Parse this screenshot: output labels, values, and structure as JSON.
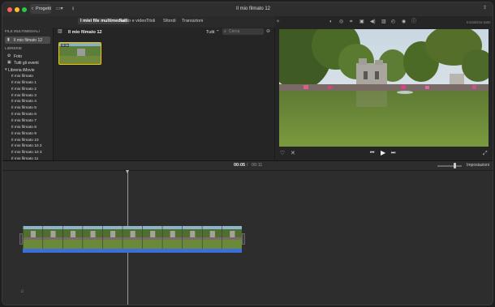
{
  "toolbar": {
    "back_label": "Progetti",
    "project_title": "Il mio filmato 12",
    "reset_all_label": "Inizializza tutto"
  },
  "tabs": [
    {
      "label": "I miei file multimediali",
      "active": true
    },
    {
      "label": "Audio e video"
    },
    {
      "label": "Titoli"
    },
    {
      "label": "Sfondi"
    },
    {
      "label": "Transizioni"
    }
  ],
  "sidebar": {
    "media_header": "FILE MULTIMEDIALI",
    "media_item": "Il mio filmato 12",
    "libraries_header": "LIBRERIE",
    "photos": "Foto",
    "all_events": "Tutti gli eventi",
    "imovie_library": "Libreria iMovie",
    "projects": [
      "Il mio filmato",
      "Il mio filmato 1",
      "Il mio filmato 2",
      "Il mio filmato 3",
      "Il mio filmato 4",
      "Il mio filmato 5",
      "Il mio filmato 6",
      "Il mio filmato 7",
      "Il mio filmato 8",
      "Il mio filmato 9",
      "Il mio filmato 10",
      "Il mio filmato 10 2",
      "Il mio filmato 10 3",
      "Il mio filmato 11"
    ]
  },
  "browser": {
    "title": "Il mio filmato 12",
    "filter_label": "Tutti",
    "search_placeholder": "Cerca",
    "clip_duration": "11,1s"
  },
  "timeline": {
    "current_time": "00:05",
    "separator": "/",
    "total_time": "00:11",
    "settings_label": "Impostazioni"
  },
  "colors": {
    "selection_yellow": "#f5c400",
    "audio_blue": "#3a6fd8",
    "playhead": "#9a9a9a"
  }
}
